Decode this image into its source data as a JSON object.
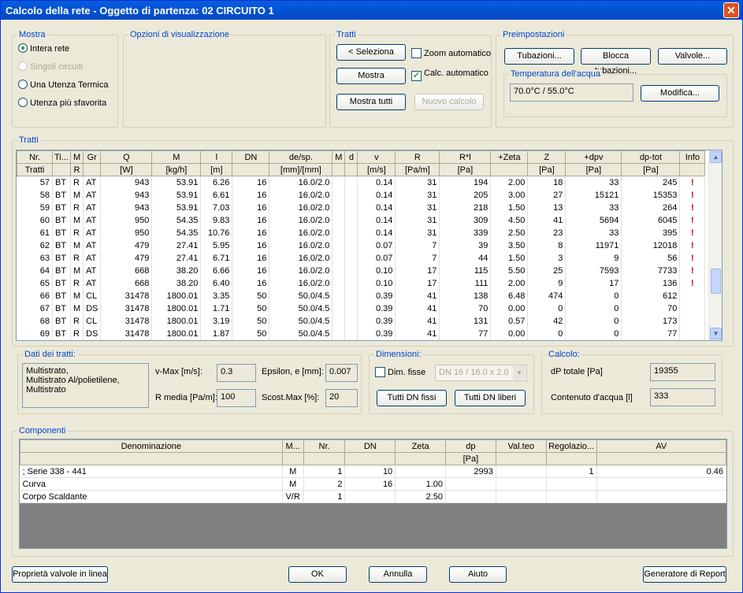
{
  "window": {
    "title": "Calcolo della rete - Oggetto di partenza: 02 CIRCUITO 1"
  },
  "mostra": {
    "label": "Mostra",
    "options": [
      {
        "label": "Intera rete",
        "checked": true,
        "enabled": true
      },
      {
        "label": "Singoli circuiti",
        "checked": false,
        "enabled": false
      },
      {
        "label": "Una Utenza Termica",
        "checked": false,
        "enabled": true
      },
      {
        "label": "Utenza più sfavorita",
        "checked": false,
        "enabled": true
      }
    ]
  },
  "opzioni": {
    "label": "Opzioni di visualizzazione"
  },
  "tratti_group": {
    "label": "Tratti",
    "seleziona": "< Seleziona",
    "mostra": "Mostra",
    "mostra_tutti": "Mostra tutti",
    "zoom_auto": "Zoom automatico",
    "calc_auto": "Calc. automatico",
    "nuovo_calcolo": "Nuovo calcolo"
  },
  "preimpostazioni": {
    "label": "Preimpostazioni",
    "tubazioni": "Tubazioni...",
    "blocca": "Blocca tubazioni...",
    "valvole": "Valvole...",
    "temp_label": "Temperatura dell'acqua",
    "temp_value": "70.0°C / 55.0°C",
    "modifica": "Modifica..."
  },
  "tratti_table": {
    "label": "Tratti",
    "headers1": [
      "Nr.",
      "Ti...",
      "M",
      "Gr",
      "Q",
      "M",
      "l",
      "DN",
      "de/sp.",
      "M",
      "d",
      "v",
      "R",
      "R*l",
      "+Zeta",
      "Z",
      "+dpv",
      "dp-tot",
      "Info"
    ],
    "headers2": [
      "Tratti",
      "",
      "R",
      "",
      "[W]",
      "[kg/h]",
      "[m]",
      "",
      "[mm]/[mm]",
      "",
      "",
      "[m/s]",
      "[Pa/m]",
      "[Pa]",
      "",
      "[Pa]",
      "[Pa]",
      "[Pa]",
      ""
    ],
    "rows": [
      [
        "57",
        "BT",
        "R",
        "AT",
        "943",
        "53.91",
        "6.26",
        "16",
        "16.0/2.0",
        "",
        "",
        "0.14",
        "31",
        "194",
        "2.00",
        "18",
        "33",
        "245",
        "!"
      ],
      [
        "58",
        "BT",
        "M",
        "AT",
        "943",
        "53.91",
        "6.61",
        "16",
        "16.0/2.0",
        "",
        "",
        "0.14",
        "31",
        "205",
        "3.00",
        "27",
        "15121",
        "15353",
        "!"
      ],
      [
        "59",
        "BT",
        "R",
        "AT",
        "943",
        "53.91",
        "7.03",
        "16",
        "16.0/2.0",
        "",
        "",
        "0.14",
        "31",
        "218",
        "1.50",
        "13",
        "33",
        "264",
        "!"
      ],
      [
        "60",
        "BT",
        "M",
        "AT",
        "950",
        "54.35",
        "9.83",
        "16",
        "16.0/2.0",
        "",
        "",
        "0.14",
        "31",
        "309",
        "4.50",
        "41",
        "5694",
        "6045",
        "!"
      ],
      [
        "61",
        "BT",
        "R",
        "AT",
        "950",
        "54.35",
        "10.76",
        "16",
        "16.0/2.0",
        "",
        "",
        "0.14",
        "31",
        "339",
        "2.50",
        "23",
        "33",
        "395",
        "!"
      ],
      [
        "62",
        "BT",
        "M",
        "AT",
        "479",
        "27.41",
        "5.95",
        "16",
        "16.0/2.0",
        "",
        "",
        "0.07",
        "7",
        "39",
        "3.50",
        "8",
        "11971",
        "12018",
        "!"
      ],
      [
        "63",
        "BT",
        "R",
        "AT",
        "479",
        "27.41",
        "6.71",
        "16",
        "16.0/2.0",
        "",
        "",
        "0.07",
        "7",
        "44",
        "1.50",
        "3",
        "9",
        "56",
        "!"
      ],
      [
        "64",
        "BT",
        "M",
        "AT",
        "668",
        "38.20",
        "6.66",
        "16",
        "16.0/2.0",
        "",
        "",
        "0.10",
        "17",
        "115",
        "5.50",
        "25",
        "7593",
        "7733",
        "!"
      ],
      [
        "65",
        "BT",
        "R",
        "AT",
        "668",
        "38.20",
        "6.40",
        "16",
        "16.0/2.0",
        "",
        "",
        "0.10",
        "17",
        "111",
        "2.00",
        "9",
        "17",
        "136",
        "!"
      ],
      [
        "66",
        "BT",
        "M",
        "CL",
        "31478",
        "1800.01",
        "3.35",
        "50",
        "50.0/4.5",
        "",
        "",
        "0.39",
        "41",
        "138",
        "6.48",
        "474",
        "0",
        "612",
        ""
      ],
      [
        "67",
        "BT",
        "M",
        "DS",
        "31478",
        "1800.01",
        "1.71",
        "50",
        "50.0/4.5",
        "",
        "",
        "0.39",
        "41",
        "70",
        "0.00",
        "0",
        "0",
        "70",
        ""
      ],
      [
        "68",
        "BT",
        "R",
        "CL",
        "31478",
        "1800.01",
        "3.19",
        "50",
        "50.0/4.5",
        "",
        "",
        "0.39",
        "41",
        "131",
        "0.57",
        "42",
        "0",
        "173",
        ""
      ],
      [
        "69",
        "BT",
        "R",
        "DS",
        "31478",
        "1800.01",
        "1.87",
        "50",
        "50.0/4.5",
        "",
        "",
        "0.39",
        "41",
        "77",
        "0.00",
        "0",
        "0",
        "77",
        ""
      ]
    ]
  },
  "dati": {
    "label": "Dati dei tratti:",
    "material": "Multistrato,\nMultistrato Al/polietilene,\nMultistrato",
    "vmax_label": "v-Max [m/s]:",
    "vmax": "0.3",
    "eps_label": "Epsilon, e [mm]:",
    "eps": "0.007",
    "rmedia_label": "R media [Pa/m]:",
    "rmedia": "100",
    "scost_label": "Scost.Max [%]:",
    "scost": "20"
  },
  "dimensioni": {
    "label": "Dimensioni:",
    "dim_fisse": "Dim. fisse",
    "dn_select": "DN 16 / 16.0 x 2.0",
    "tutti_fissi": "Tutti DN fissi",
    "tutti_liberi": "Tutti DN liberi"
  },
  "calcolo": {
    "label": "Calcolo:",
    "dp_label": "dP totale [Pa]",
    "dp": "19355",
    "acqua_label": "Contenuto d'acqua [l]",
    "acqua": "333"
  },
  "componenti": {
    "label": "Componenti",
    "headers1": [
      "Denominazione",
      "M...",
      "Nr.",
      "DN",
      "Zeta",
      "dp",
      "Val.teo",
      "Regolazio...",
      "AV"
    ],
    "headers2": [
      "",
      "",
      "",
      "",
      "",
      "[Pa]",
      "",
      "",
      ""
    ],
    "rows": [
      [
        "; Serie 338 - 441",
        "M",
        "1",
        "10",
        "",
        "2993",
        "",
        "1",
        "0.46"
      ],
      [
        "Curva",
        "M",
        "2",
        "16",
        "1.00",
        "",
        "",
        "",
        ""
      ],
      [
        "Corpo Scaldante",
        "V/R",
        "1",
        "",
        "2.50",
        "",
        "",
        "",
        ""
      ]
    ]
  },
  "footer": {
    "proprieta": "Proprietà valvole in linea",
    "ok": "OK",
    "annulla": "Annulla",
    "aiuto": "Aiuto",
    "report": "Generatore di Report"
  }
}
